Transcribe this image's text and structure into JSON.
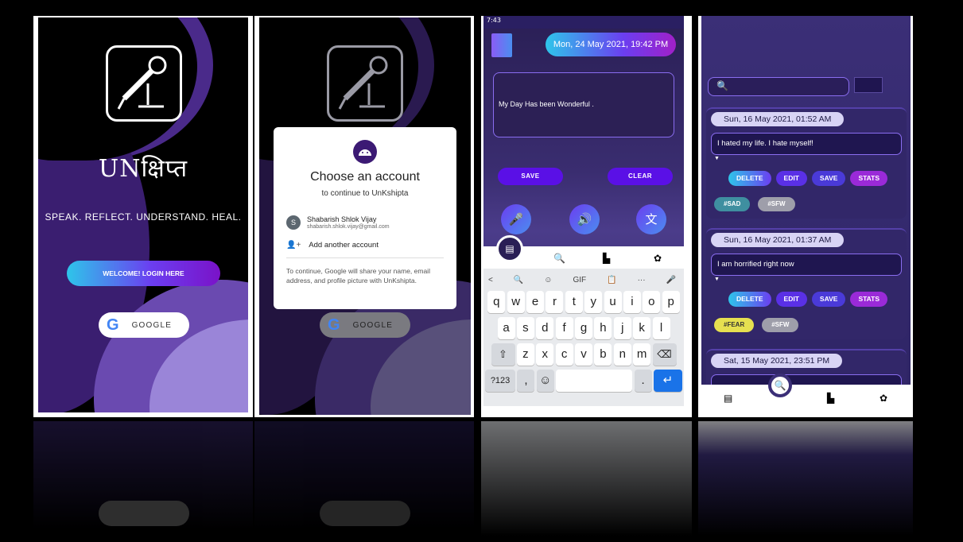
{
  "login": {
    "app_title": "UNक्षिप्त",
    "tagline": "SPEAK. REFLECT. UNDERSTAND. HEAL.",
    "welcome_btn": "WELCOME! LOGIN HERE",
    "google_btn": "GOOGLE",
    "google_letter": "G"
  },
  "chooser": {
    "title": "Choose an account",
    "subtitle": "to continue to UnKshipta",
    "account_name": "Shabarish Shlok Vijay",
    "account_email": "shabarish.shlok.vijay@gmail.com",
    "avatar_letter": "S",
    "add_account": "Add another account",
    "legal": "To continue, Google will share your name, email address, and profile picture with UnKshipta.",
    "google_btn": "GOOGLE",
    "google_letter": "G"
  },
  "journal": {
    "status_time": "7:43",
    "date": "Mon, 24 May 2021, 19:42 PM",
    "entry_text": "My Day Has been Wonderful .",
    "save_btn": "SAVE",
    "clear_btn": "CLEAR",
    "nav_icons": [
      "journal-icon",
      "search-icon",
      "stats-icon",
      "settings-icon"
    ]
  },
  "keyboard": {
    "toolbar": [
      "<",
      "🔍",
      "☺",
      "GIF",
      "📋",
      "···",
      "🎤"
    ],
    "row1": [
      "q",
      "w",
      "e",
      "r",
      "t",
      "y",
      "u",
      "i",
      "o",
      "p"
    ],
    "row2": [
      "a",
      "s",
      "d",
      "f",
      "g",
      "h",
      "j",
      "k",
      "l"
    ],
    "row3": [
      "z",
      "x",
      "c",
      "v",
      "b",
      "n",
      "m"
    ],
    "mode_key": "?123",
    "comma": ",",
    "emoji": "☺",
    "period": ".",
    "enter": "↵",
    "shift": "⇧",
    "backspace": "⌫"
  },
  "entries": {
    "search_icon": "🔍",
    "cards": [
      {
        "date": "Sun, 16 May 2021, 01:52 AM",
        "text": "I hated my life. I hate myself!",
        "tags": [
          "#SAD",
          "#SFW"
        ]
      },
      {
        "date": "Sun, 16 May 2021, 01:37 AM",
        "text": "I am horrified right now",
        "tags": [
          "#FEAR",
          "#SFW"
        ]
      },
      {
        "date": "Sat, 15 May 2021, 23:51 PM",
        "text": "",
        "tags": []
      }
    ],
    "actions": [
      "DELETE",
      "EDIT",
      "SAVE",
      "STATS"
    ]
  },
  "colors": {
    "accent": "#6b3ef0",
    "cyan": "#2ec5ea",
    "bg_dark": "#2a1f55"
  }
}
